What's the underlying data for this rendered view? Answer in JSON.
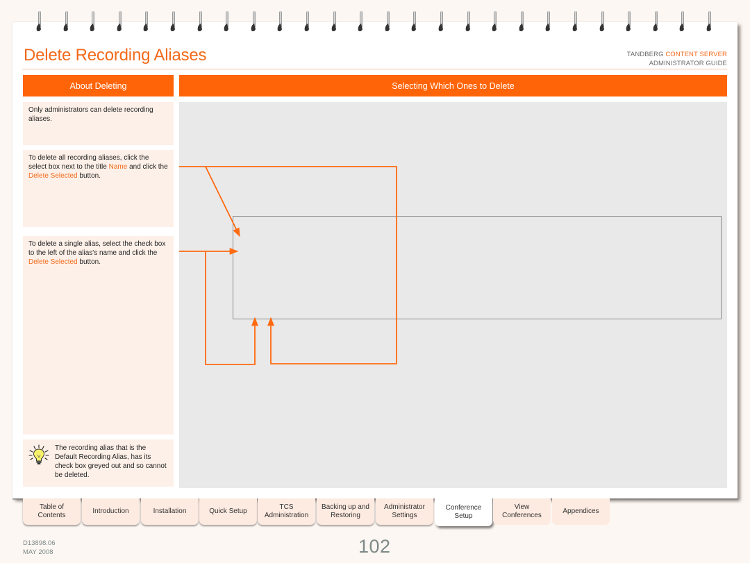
{
  "header": {
    "title": "Delete Recording Aliases",
    "brand_prefix": "TANDBERG ",
    "brand_accent": "CONTENT SERVER",
    "brand_sub": "ADMINISTRATOR GUIDE"
  },
  "colors": {
    "accent": "#ff6408",
    "title": "#f26a1b",
    "note_bg": "#fdf0e8",
    "canvas_bg": "#e9e9e9"
  },
  "left_column": {
    "heading": "About Deleting",
    "notes": [
      {
        "text": "Only administrators can delete recording aliases."
      },
      {
        "pre": "To delete all recording aliases, click the select box next to the title ",
        "hl1": "Name",
        "mid": " and click the ",
        "hl2": "Delete Selected",
        "post": " button."
      },
      {
        "pre": "To delete a single alias, select the check box to the left of the alias's name and click the ",
        "hl": "Delete Selected",
        "post": " button."
      }
    ],
    "tip": {
      "icon": "lightbulb-icon",
      "text": "The recording alias that is the Default Recording Alias, has its check box greyed out and so cannot be deleted."
    }
  },
  "right_column": {
    "heading": "Selecting Which Ones to Delete"
  },
  "nav_tabs": [
    {
      "label_line1": "Table of",
      "label_line2": "Contents",
      "active": false
    },
    {
      "label_line1": "Introduction",
      "label_line2": "",
      "active": false
    },
    {
      "label_line1": "Installation",
      "label_line2": "",
      "active": false
    },
    {
      "label_line1": "Quick Setup",
      "label_line2": "",
      "active": false
    },
    {
      "label_line1": "TCS",
      "label_line2": "Administration",
      "active": false
    },
    {
      "label_line1": "Backing up and",
      "label_line2": "Restoring",
      "active": false
    },
    {
      "label_line1": "Administrator",
      "label_line2": "Settings",
      "active": false
    },
    {
      "label_line1": "Conference",
      "label_line2": "Setup",
      "active": true
    },
    {
      "label_line1": "View",
      "label_line2": "Conferences",
      "active": false
    },
    {
      "label_line1": "Appendices",
      "label_line2": "",
      "active": false
    }
  ],
  "footer": {
    "doc_id": "D13898.06",
    "date": "MAY 2008",
    "page_number": "102"
  }
}
